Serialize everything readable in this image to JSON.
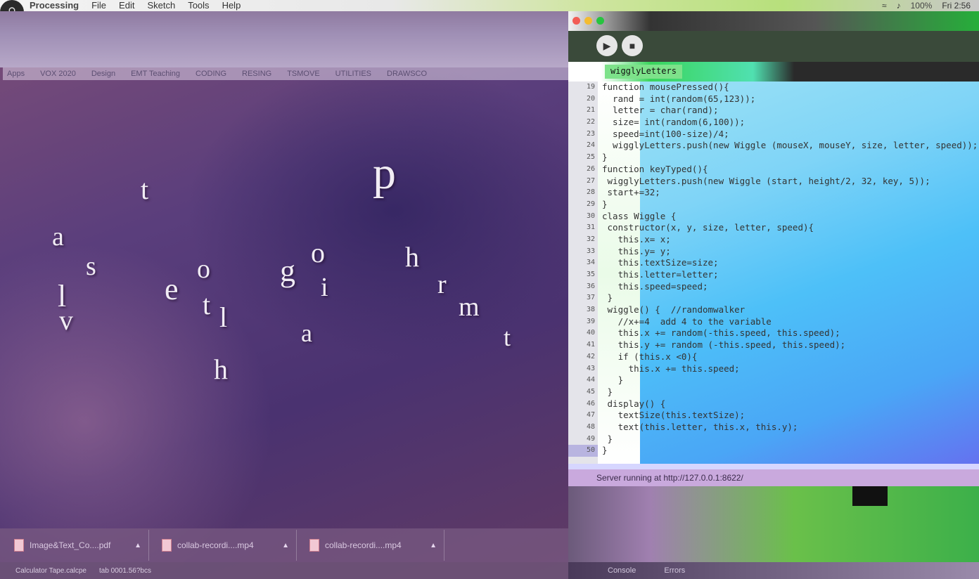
{
  "menubar": {
    "app_name": "Processing",
    "menus": [
      "File",
      "Edit",
      "Sketch",
      "Tools",
      "Help"
    ],
    "battery": "100%",
    "clock": "Fri 2:56"
  },
  "bookmarks": [
    "Apps",
    "VOX 2020",
    "Design",
    "EMT Teaching",
    "CODING",
    "RESING",
    "TSMOVE",
    "UTILITIES",
    "DRAWSCO"
  ],
  "canvas_letters": [
    {
      "char": "t"
    },
    {
      "char": "p"
    },
    {
      "char": "a"
    },
    {
      "char": "s"
    },
    {
      "char": "o"
    },
    {
      "char": "g"
    },
    {
      "char": "o"
    },
    {
      "char": "h"
    },
    {
      "char": "i"
    },
    {
      "char": "l"
    },
    {
      "char": "v"
    },
    {
      "char": "e"
    },
    {
      "char": "t"
    },
    {
      "char": "l"
    },
    {
      "char": "r"
    },
    {
      "char": "m"
    },
    {
      "char": "a"
    },
    {
      "char": "t"
    },
    {
      "char": "h"
    }
  ],
  "editor": {
    "tab_label": "wigglyLetters",
    "line_numbers": [
      "19",
      "20",
      "21",
      "22",
      "23",
      "24",
      "25",
      "26",
      "27",
      "28",
      "29",
      "30",
      "31",
      "32",
      "33",
      "34",
      "35",
      "36",
      "37",
      "38",
      "39",
      "40",
      "41",
      "42",
      "43",
      "44",
      "45",
      "46",
      "47",
      "48",
      "49",
      "50"
    ],
    "code_lines": [
      "function mousePressed(){",
      "  rand = int(random(65,123));",
      "  letter = char(rand);",
      "  size= int(random(6,100));",
      "  speed=int(100-size)/4;",
      "  wigglyLetters.push(new Wiggle (mouseX, mouseY, size, letter, speed));",
      "}",
      "function keyTyped(){",
      " wigglyLetters.push(new Wiggle (start, height/2, 32, key, 5));",
      " start+=32;",
      "}",
      "class Wiggle {",
      " constructor(x, y, size, letter, speed){",
      "   this.x= x;",
      "   this.y= y;",
      "   this.textSize=size;",
      "   this.letter=letter;",
      "   this.speed=speed;",
      " }",
      " wiggle() {  //randomwalker",
      "   //x+=4  add 4 to the variable",
      "   this.x += random(-this.speed, this.speed);",
      "   this.y += random (-this.speed, this.speed);",
      "   if (this.x <0){",
      "     this.x += this.speed;",
      "   }",
      " }",
      " display() {",
      "   textSize(this.textSize);",
      "   text(this.letter, this.x, this.y);",
      " }",
      "}"
    ],
    "console_text": "Server running at http://127.0.0.1:8622/"
  },
  "bottom_tabs": [
    "Console",
    "Errors"
  ],
  "downloads": [
    {
      "name": "Image&Text_Co....pdf"
    },
    {
      "name": "collab-recordi....mp4"
    },
    {
      "name": "collab-recordi....mp4"
    }
  ],
  "statusline": [
    "Calculator Tape.calcpe",
    "tab 0001.56?bcs"
  ],
  "colors": {
    "canvas_bg": "#5a3e7c",
    "editor_accent": "#3ad55c",
    "code_bg": "#4dc0f8"
  }
}
